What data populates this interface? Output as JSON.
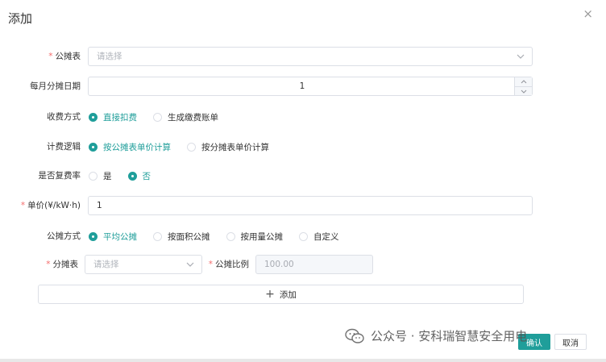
{
  "dialog": {
    "title": "添加",
    "close_icon": "×"
  },
  "form": {
    "gongtan_table": {
      "label": "公摊表",
      "required": "*",
      "placeholder": "请选择"
    },
    "monthly_date": {
      "label": "每月分摊日期",
      "value": "1"
    },
    "charge_method": {
      "label": "收费方式",
      "options": [
        "直接扣费",
        "生成缴费账单"
      ],
      "selected": "直接扣费"
    },
    "billing_logic": {
      "label": "计费逻辑",
      "options": [
        "按公摊表单价计算",
        "按分摊表单价计算"
      ],
      "selected": "按公摊表单价计算"
    },
    "compound_rate": {
      "label": "是否复费率",
      "options": [
        "是",
        "否"
      ],
      "selected": "否"
    },
    "unit_price": {
      "label": "单价(¥/kW·h)",
      "required": "*",
      "value": "1"
    },
    "gongtan_method": {
      "label": "公摊方式",
      "options": [
        "平均公摊",
        "按面积公摊",
        "按用量公摊",
        "自定义"
      ],
      "selected": "平均公摊"
    },
    "fentan_row": {
      "fentan_label": "分摊表",
      "fentan_required": "*",
      "fentan_placeholder": "请选择",
      "ratio_label": "公摊比例",
      "ratio_required": "*",
      "ratio_value": "100.00"
    },
    "add_button": {
      "plus": "+",
      "label": "添加"
    }
  },
  "footer": {
    "confirm": "确认",
    "cancel": "取消"
  },
  "watermark": {
    "text": "公众号 · 安科瑞智慧安全用电"
  },
  "colors": {
    "accent": "#1f9e9a",
    "required": "#f56c6c",
    "border": "#dcdfe6"
  }
}
